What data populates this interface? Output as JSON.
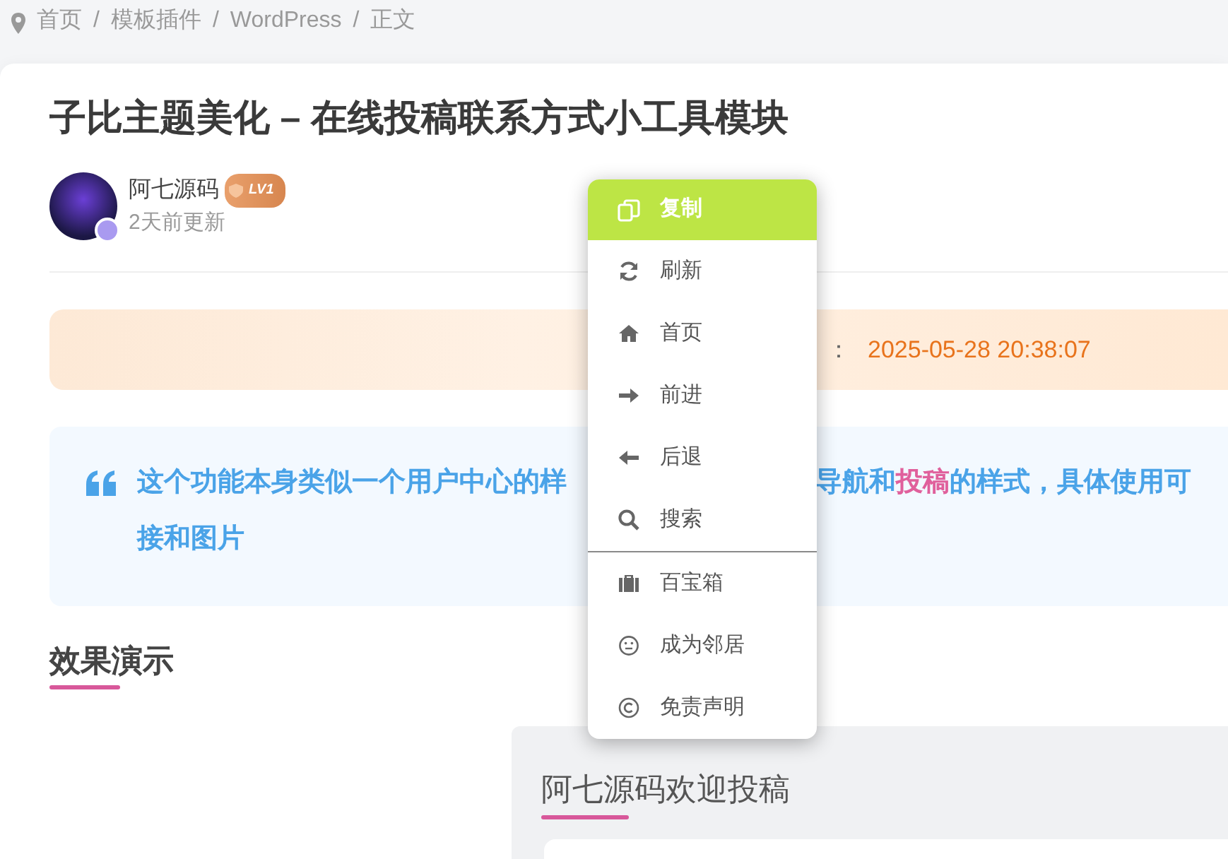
{
  "breadcrumb": {
    "separator": "/",
    "items": [
      "首页",
      "模板插件",
      "WordPress",
      "正文"
    ]
  },
  "article": {
    "title": "子比主题美化 – 在线投稿联系方式小工具模块",
    "author": {
      "name": "阿七源码",
      "level_badge": "LV1",
      "updated": "2天前更新"
    },
    "update_banner": {
      "label_visible_part": "：",
      "time": "2025-05-28 20:38:07"
    },
    "quote": {
      "line_1_left": "这个功能本身类似一个用户中心的样",
      "line_1_right": "导航和**投稿**的样式，具体使用可",
      "line_2": "接和图片"
    },
    "section_heading": "效果演示",
    "demo_panel": {
      "title": "阿七源码欢迎投稿"
    }
  },
  "context_menu": [
    {
      "label": "复制",
      "selected": true,
      "divider_after": false
    },
    {
      "label": "刷新",
      "selected": false,
      "divider_after": false
    },
    {
      "label": "首页",
      "selected": false,
      "divider_after": false
    },
    {
      "label": "前进",
      "selected": false,
      "divider_after": false
    },
    {
      "label": "后退",
      "selected": false,
      "divider_after": false
    },
    {
      "label": "搜索",
      "selected": false,
      "divider_after": true
    },
    {
      "label": "百宝箱",
      "selected": false,
      "divider_after": false
    },
    {
      "label": "成为邻居",
      "selected": false,
      "divider_after": false
    },
    {
      "label": "免责声明",
      "selected": false,
      "divider_after": false
    }
  ]
}
